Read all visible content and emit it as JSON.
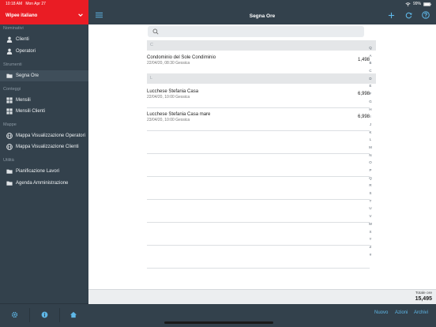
{
  "status": {
    "time": "10:18 AM",
    "date": "Mon Apr 27",
    "battery": "99%"
  },
  "sidebar": {
    "company": "Wipee italiano",
    "sections": [
      {
        "label": "Nominativi",
        "items": [
          {
            "label": "Clienti",
            "icon": "person-icon"
          },
          {
            "label": "Operatori",
            "icon": "person-icon"
          }
        ]
      },
      {
        "label": "Strumenti",
        "items": [
          {
            "label": "Segna Ore",
            "icon": "folder-icon",
            "active": true
          }
        ]
      },
      {
        "label": "Conteggi",
        "items": [
          {
            "label": "Mensili",
            "icon": "grid-icon"
          },
          {
            "label": "Mensili Clienti",
            "icon": "grid-icon"
          }
        ]
      },
      {
        "label": "Mappe",
        "items": [
          {
            "label": "Mappa Visualizzazione Operatori",
            "icon": "globe-icon"
          },
          {
            "label": "Mappa Visualizzazione Clienti",
            "icon": "globe-icon"
          }
        ]
      },
      {
        "label": "Utilità",
        "items": [
          {
            "label": "Pianificazione Lavori",
            "icon": "folder-icon"
          },
          {
            "label": "Agenda Amministrazione",
            "icon": "folder-icon"
          }
        ]
      }
    ]
  },
  "topbar": {
    "title": "Segna Ore"
  },
  "search": {
    "placeholder": "",
    "value": ""
  },
  "list": {
    "groups": [
      {
        "header": "C",
        "rows": [
          {
            "title": "Condominio del Sole Condiminio",
            "subtitle": "22/04/20, 08:30 Gessica",
            "value": "1,498"
          }
        ]
      },
      {
        "header": "L",
        "rows": [
          {
            "title": "Lucchese Stefania Casa",
            "subtitle": "22/04/20, 10:00 Gessica",
            "value": "6,998"
          },
          {
            "title": "Lucchese Stefania Casa mare",
            "subtitle": "23/04/20, 10:00 Gessica",
            "value": "6,998"
          }
        ]
      }
    ]
  },
  "alphabet": [
    "Q",
    "A",
    "B",
    "C",
    "D",
    "E",
    "F",
    "G",
    "H",
    "I",
    "J",
    "K",
    "L",
    "M",
    "N",
    "O",
    "P",
    "Q",
    "R",
    "S",
    "T",
    "U",
    "V",
    "W",
    "X",
    "Y",
    "Z",
    "#"
  ],
  "totals": {
    "label": "Totale ore",
    "value": "15,495"
  },
  "bottombar": {
    "links": [
      "Nuovo",
      "Azioni",
      "Archivi"
    ]
  },
  "colors": {
    "brand_red": "#ea1c24",
    "chrome": "#33414c",
    "link": "#5fb8e8"
  }
}
